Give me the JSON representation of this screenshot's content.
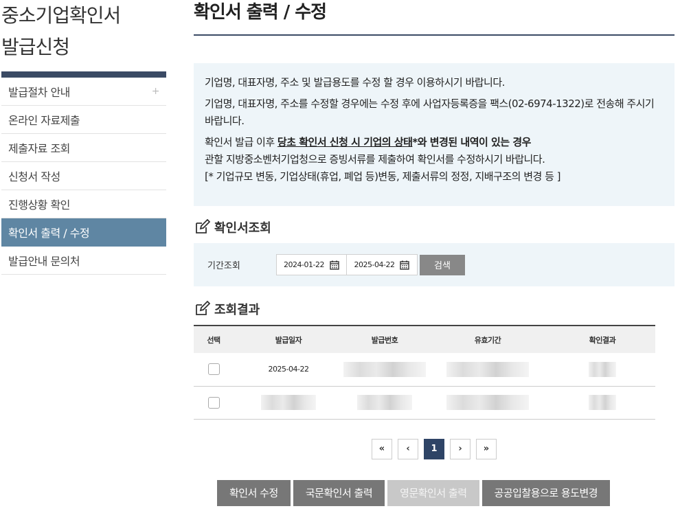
{
  "sidebar": {
    "title_line1": "중소기업확인서",
    "title_line2": "발급신청",
    "items": [
      {
        "label": "발급절차 안내",
        "plus": "+"
      },
      {
        "label": "온라인 자료제출"
      },
      {
        "label": "제출자료 조회"
      },
      {
        "label": "신청서 작성"
      },
      {
        "label": "진행상황 확인"
      },
      {
        "label": "확인서 출력 / 수정"
      },
      {
        "label": "발급안내 문의처"
      }
    ]
  },
  "main": {
    "title": "확인서 출력 / 수정",
    "notice": {
      "line1": "기업명, 대표자명, 주소 및 발급용도를 수정 할 경우 이용하시기 바랍니다.",
      "line2": "기업명, 대표자명, 주소를 수정할 경우에는 수정 후에 사업자등록증을 팩스(02-6974-1322)로 전송해 주시기 바랍니다.",
      "line3_pre": "확인서 발급 이후 ",
      "line3_underline": "당초 확인서 신청 시 기업의 상태",
      "line3_post": "*와 변경된 내역이 있는 경우",
      "line4": "관할 지방중소벤처기업청으로 증빙서류를 제출하여 확인서를 수정하시기 바랍니다.",
      "line5": "[* 기업규모 변동, 기업상태(휴업, 폐업 등)변동, 제출서류의 정정, 지배구조의 변경 등 ]"
    },
    "search_section": {
      "heading": "확인서조회",
      "label": "기간조회",
      "date_from": "2024-01-22",
      "date_to": "2025-04-22",
      "button": "검색"
    },
    "results_section": {
      "heading": "조회결과",
      "columns": [
        "선택",
        "발급일자",
        "발급번호",
        "유효기간",
        "확인결과"
      ],
      "rows": [
        {
          "date": "2025-04-22"
        },
        {
          "date": ""
        }
      ]
    },
    "pagination": {
      "first": "«",
      "prev": "‹",
      "current": "1",
      "next": "›",
      "last": "»"
    },
    "actions": {
      "edit": "확인서 수정",
      "print_kr": "국문확인서 출력",
      "print_en": "영문확인서 출력",
      "change_use": "공공입찰용으로 용도변경"
    }
  }
}
